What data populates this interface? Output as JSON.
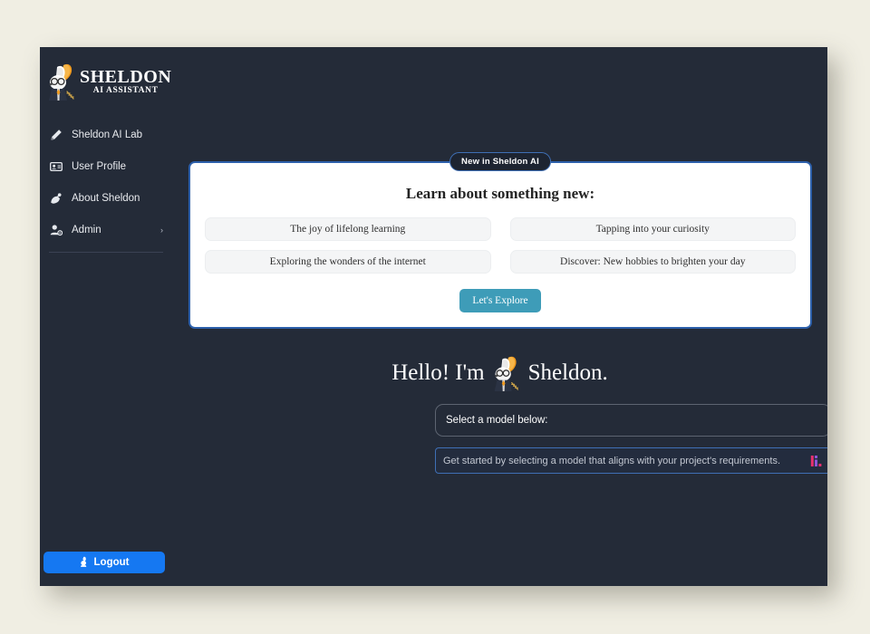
{
  "brand": {
    "title": "SHELDON",
    "subtitle": "AI ASSISTANT",
    "logo_icon": "rabbit-mascot-icon"
  },
  "sidebar": {
    "items": [
      {
        "label": "Sheldon AI Lab",
        "icon": "pen-icon",
        "chevron": ""
      },
      {
        "label": "User Profile",
        "icon": "id-card-icon",
        "chevron": ""
      },
      {
        "label": "About Sheldon",
        "icon": "satellite-dish-icon",
        "chevron": ""
      },
      {
        "label": "Admin",
        "icon": "user-gear-icon",
        "chevron": "›"
      }
    ],
    "logout": {
      "label": "Logout",
      "icon": "logout-rabbit-icon"
    }
  },
  "promo": {
    "badge": "New in Sheldon AI",
    "title": "Learn about something new:",
    "suggestions": [
      "The joy of lifelong learning",
      "Tapping into your curiosity",
      "Exploring the wonders of the internet",
      "Discover: New hobbies to brighten your day"
    ],
    "cta": "Let's Explore"
  },
  "greeting": {
    "prefix": "Hello! I'm",
    "suffix": "Sheldon.",
    "mascot_icon": "rabbit-mascot-icon"
  },
  "model_select": {
    "value": "Select a model below:"
  },
  "hint": {
    "text": "Get started by selecting a model that aligns with your project's requirements.",
    "logo_icon": "ai-logo-icon"
  },
  "colors": {
    "page_background": "#f0eee3",
    "app_background": "#242b38",
    "card_border": "#2d60ab",
    "cta": "#3e9cb8",
    "logout": "#1578f2",
    "hint_border": "#3f6fb5",
    "ai_logo": "#e8306e"
  }
}
